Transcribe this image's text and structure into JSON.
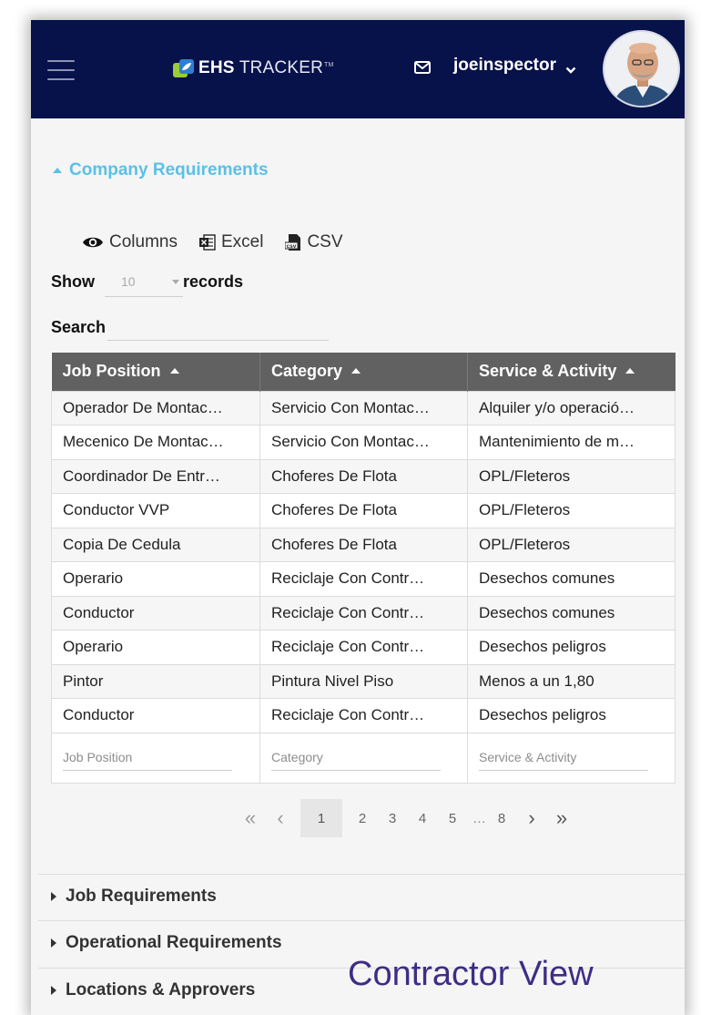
{
  "header": {
    "logo_bold": "EHS",
    "logo_light": "TRACKER",
    "logo_tm": "TM",
    "username": "joeinspector",
    "icons": [
      "menu-icon",
      "envelope-icon",
      "chevron-down-icon"
    ]
  },
  "company_requirements": {
    "title": "Company Requirements",
    "tools": {
      "columns": "Columns",
      "excel": "Excel",
      "csv": "CSV"
    },
    "show_label": "Show",
    "show_value": "10",
    "records_label": "records",
    "search_label": "Search",
    "search_value": ""
  },
  "table": {
    "headers": [
      "Job Position",
      "Category",
      "Service & Activity"
    ],
    "rows": [
      [
        "Operador De Montac…",
        "Servicio Con Montac…",
        "Alquiler y/o operació…"
      ],
      [
        "Mecenico De Montac…",
        "Servicio Con Montac…",
        "Mantenimiento de m…"
      ],
      [
        "Coordinador De Entr…",
        "Choferes De Flota",
        "OPL/Fleteros"
      ],
      [
        "Conductor VVP",
        "Choferes De Flota",
        "OPL/Fleteros"
      ],
      [
        "Copia De Cedula",
        "Choferes De Flota",
        "OPL/Fleteros"
      ],
      [
        "Operario",
        "Reciclaje Con Contr…",
        "Desechos comunes"
      ],
      [
        "Conductor",
        "Reciclaje Con Contr…",
        "Desechos comunes"
      ],
      [
        "Operario",
        "Reciclaje Con Contr…",
        "Desechos peligros"
      ],
      [
        "Pintor",
        "Pintura Nivel Piso",
        "Menos a un 1,80"
      ],
      [
        "Conductor",
        "Reciclaje Con Contr…",
        "Desechos peligros"
      ]
    ],
    "filter_placeholders": [
      "Job Position",
      "Category",
      "Service & Activity"
    ]
  },
  "pagination": {
    "first": "«",
    "prev": "‹",
    "pages": [
      "1",
      "2",
      "3",
      "4",
      "5"
    ],
    "ellipsis": "…",
    "last_page": "8",
    "next": "›",
    "last": "»",
    "current": "1"
  },
  "sections": {
    "job": "Job Requirements",
    "operational": "Operational Requirements",
    "locations": "Locations & Approvers"
  },
  "watermark": "Contractor View",
  "colors": {
    "header_bg": "#07114a",
    "accent": "#5bc0e6",
    "table_header": "#616161",
    "watermark": "#3e2d86"
  }
}
